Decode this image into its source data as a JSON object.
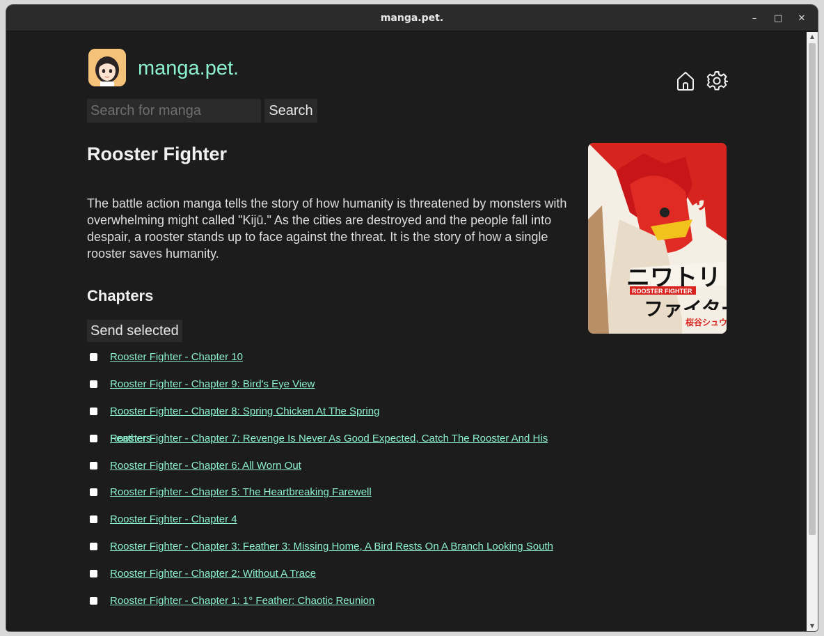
{
  "window": {
    "title": "manga.pet.",
    "controls": {
      "minimize": "–",
      "maximize": "□",
      "close": "✕"
    }
  },
  "header": {
    "site_name": "manga.pet.",
    "logo_icon": "anime-girl-avatar",
    "home_icon": "home-icon",
    "settings_icon": "gear-icon",
    "accent_color": "#8cf0cf"
  },
  "search": {
    "placeholder": "Search for manga",
    "value": "",
    "button_label": "Search"
  },
  "manga": {
    "title": "Rooster Fighter",
    "description": "The battle action manga tells the story of how humanity is threatened by monsters with overwhelming might called \"Kijū.\" As the cities are destroyed and the people fall into despair, a rooster stands up to face against the threat. It is the story of how a single rooster saves humanity.",
    "cover_alt": "Rooster Fighter cover"
  },
  "chapters": {
    "heading": "Chapters",
    "send_selected_label": "Send selected",
    "items": [
      {
        "label": "Rooster Fighter - Chapter 10",
        "checked": false
      },
      {
        "label": "Rooster Fighter - Chapter 9: Bird's Eye View",
        "checked": false
      },
      {
        "label": "Rooster Fighter - Chapter 8: Spring Chicken At The Spring",
        "checked": false
      },
      {
        "label": "Rooster Fighter - Chapter 7: Revenge Is Never As Good Expected, Catch The Rooster And His",
        "checked": false,
        "overlay": "Feathers"
      },
      {
        "label": "Rooster Fighter - Chapter 6: All Worn Out",
        "checked": false
      },
      {
        "label": "Rooster Fighter - Chapter 5: The Heartbreaking Farewell",
        "checked": false
      },
      {
        "label": "Rooster Fighter - Chapter 4",
        "checked": false
      },
      {
        "label": "Rooster Fighter - Chapter 3: Feather 3: Missing Home, A Bird Rests On A Branch Looking South",
        "checked": false
      },
      {
        "label": "Rooster Fighter - Chapter 2: Without A Trace",
        "checked": false
      },
      {
        "label": "Rooster Fighter - Chapter 1: 1° Feather: Chaotic Reunion",
        "checked": false
      }
    ]
  }
}
